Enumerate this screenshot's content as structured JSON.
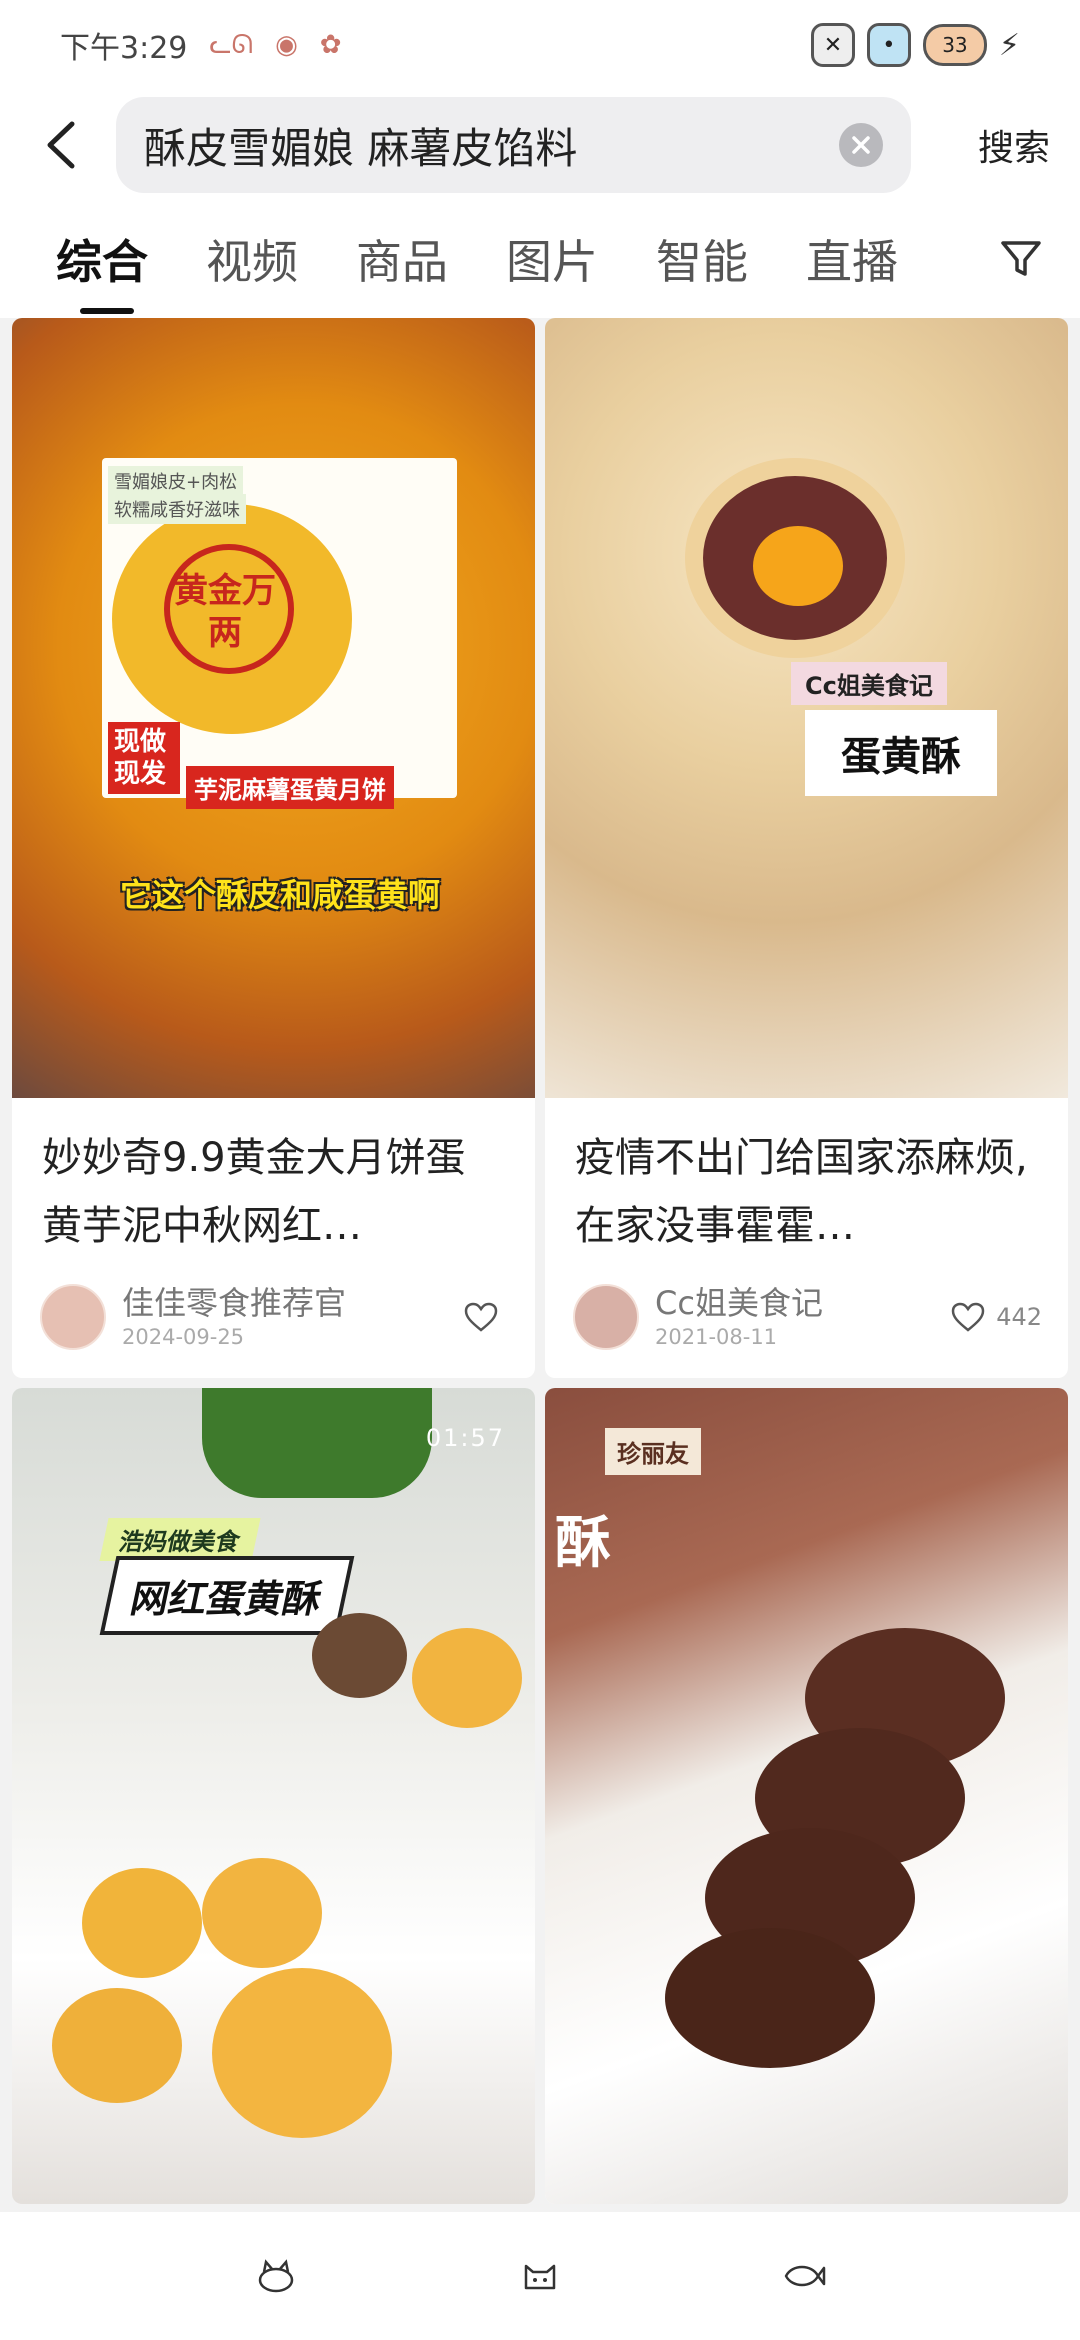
{
  "status_bar": {
    "time": "下午3:29",
    "left_icons": [
      "cat-face-icon",
      "bird-icon",
      "paw-icon"
    ],
    "right_icons": [
      "cat-sticker-icon",
      "cat-sticker-icon",
      "fish-battery-icon",
      "charging-bolt-icon"
    ],
    "battery_text": "33"
  },
  "search": {
    "query": "酥皮雪媚娘 麻薯皮馅料",
    "submit_label": "搜索"
  },
  "tabs": [
    {
      "label": "综合",
      "active": true
    },
    {
      "label": "视频",
      "active": false
    },
    {
      "label": "商品",
      "active": false
    },
    {
      "label": "图片",
      "active": false
    },
    {
      "label": "智能",
      "active": false
    },
    {
      "label": "直播",
      "active": false
    }
  ],
  "feed": {
    "cards": [
      {
        "title": "妙妙奇9.9黄金大月饼蛋黄芋泥中秋网红…",
        "author": "佳佳零食推荐官",
        "date": "2024-09-25",
        "likes": "",
        "image_texts": {
          "badge_top": "雪媚娘皮+肉松",
          "badge_sub": "软糯咸香好滋味",
          "stamp": "黄金万两",
          "promo_left": "现做现发",
          "product": "芋泥麻薯蛋黄月饼",
          "subtitle": "它这个酥皮和咸蛋黄啊"
        }
      },
      {
        "title": "疫情不出门给国家添麻烦,在家没事霍霍…",
        "author": "Cc姐美食记",
        "date": "2021-08-11",
        "likes": "442",
        "image_texts": {
          "channel_tag": "Cc姐美食记",
          "label": "蛋黄酥"
        }
      },
      {
        "title": "",
        "author": "",
        "date": "",
        "likes": "",
        "image_texts": {
          "duration": "01:57",
          "channel_tag": "浩妈做美食",
          "label": "网红蛋黄酥"
        }
      },
      {
        "title": "",
        "author": "",
        "date": "",
        "likes": "",
        "image_texts": {
          "brand": "珍丽友",
          "box_text": "酥"
        }
      }
    ]
  },
  "bottom_bar": {
    "icons": [
      "cat-icon",
      "cat-face-icon",
      "fish-icon"
    ]
  },
  "colors": {
    "accent": "#111111",
    "background": "#f2f2f2",
    "card": "#ffffff",
    "search_bg": "#eeeef0"
  }
}
